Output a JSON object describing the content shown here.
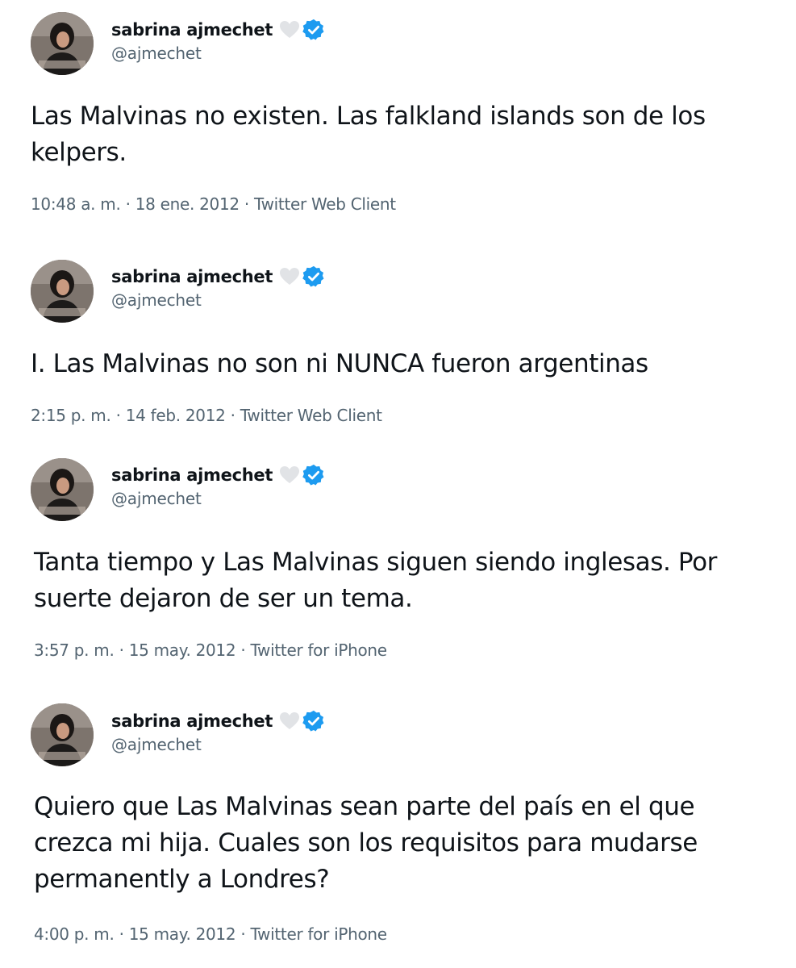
{
  "tweets": [
    {
      "author": {
        "name": "sabrina ajmechet",
        "handle": "@ajmechet",
        "verified": true,
        "extra_emoji": "white-heart-icon"
      },
      "text": "Las Malvinas no existen. Las falkland islands son de los kelpers.",
      "time": "10:48 a. m.",
      "date": "18 ene. 2012",
      "source": "Twitter Web Client",
      "sep": "·"
    },
    {
      "author": {
        "name": "sabrina ajmechet",
        "handle": "@ajmechet",
        "verified": true,
        "extra_emoji": "white-heart-icon"
      },
      "text": "I. Las Malvinas no son ni NUNCA fueron argentinas",
      "time": "2:15 p. m.",
      "date": "14 feb. 2012",
      "source": "Twitter Web Client",
      "sep": "·"
    },
    {
      "author": {
        "name": "sabrina ajmechet",
        "handle": "@ajmechet",
        "verified": true,
        "extra_emoji": "white-heart-icon"
      },
      "text": "Tanta tiempo y Las Malvinas siguen siendo inglesas. Por suerte dejaron de ser un tema.",
      "time": "3:57 p. m.",
      "date": "15 may. 2012",
      "source": "Twitter for iPhone",
      "sep": "·"
    },
    {
      "author": {
        "name": "sabrina ajmechet",
        "handle": "@ajmechet",
        "verified": true,
        "extra_emoji": "white-heart-icon"
      },
      "text": "Quiero que Las Malvinas sean parte del país en el que crezca mi hija. Cuales son los requisitos para mudarse permanently a Londres?",
      "time": "4:00 p. m.",
      "date": "15 may. 2012",
      "source": "Twitter for iPhone",
      "sep": "·"
    }
  ],
  "colors": {
    "text": "#0f1419",
    "secondary": "#536471",
    "verified": "#1d9bf0",
    "heart": "#e1e3e6"
  }
}
